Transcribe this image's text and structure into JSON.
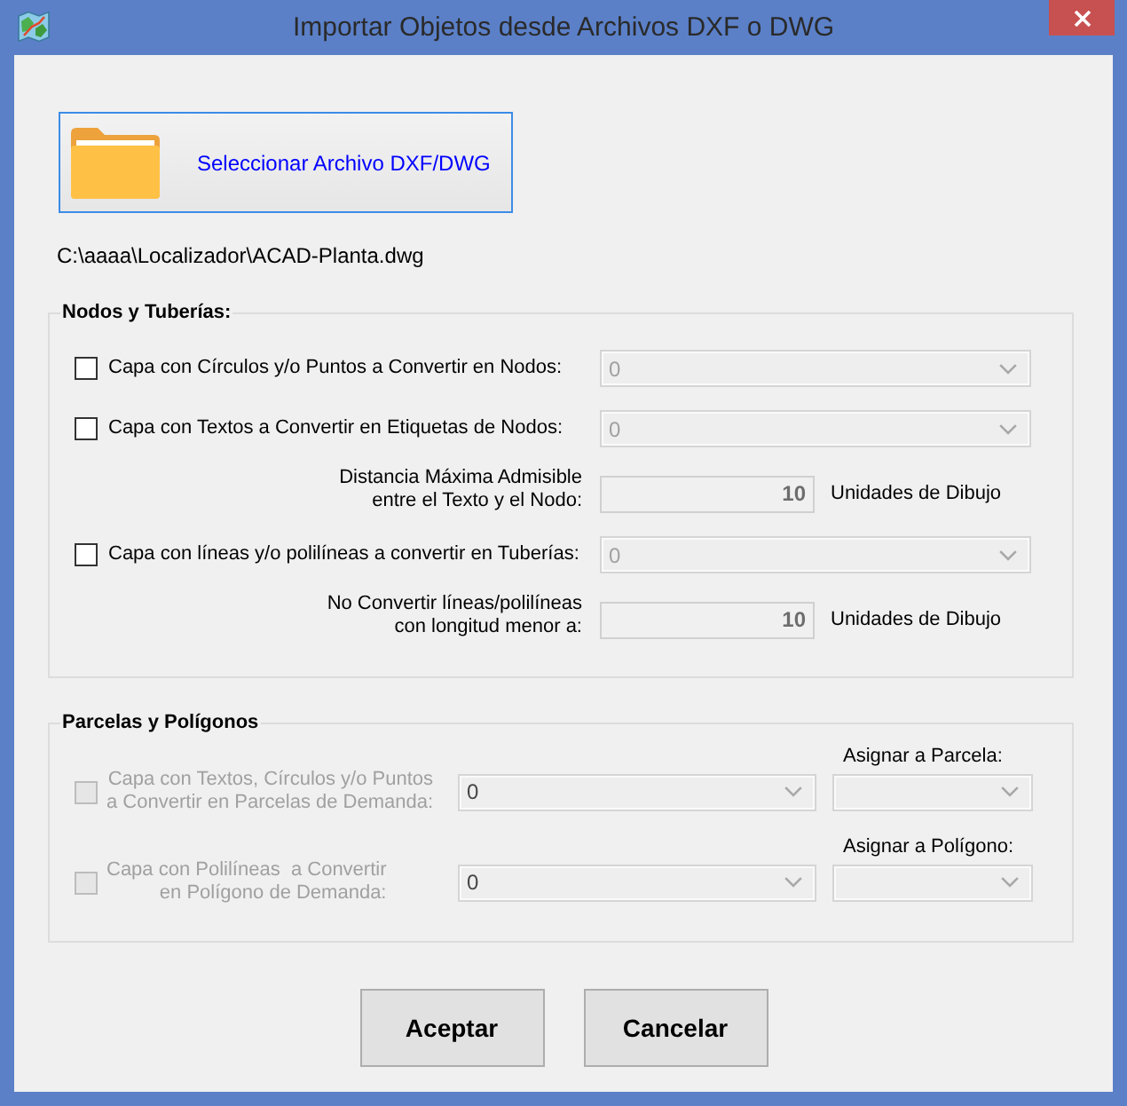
{
  "window": {
    "title": "Importar Objetos desde Archivos DXF o DWG"
  },
  "select_button": {
    "label": "Seleccionar Archivo DXF/DWG",
    "focused": true
  },
  "file_path": "C:\\aaaa\\Localizador\\ACAD-Planta.dwg",
  "groups": [
    {
      "title": "Nodos y Tuberías:",
      "rows": [
        {
          "kind": "layer",
          "label": "Capa con Círculos y/o Puntos a Convertir en Nodos:",
          "checked": false,
          "disabled": false,
          "dropdown": {
            "value": "0",
            "disabled": true
          }
        },
        {
          "kind": "layer",
          "label": "Capa con Textos a Convertir en Etiquetas de Nodos:",
          "checked": false,
          "disabled": false,
          "dropdown": {
            "value": "0",
            "disabled": true
          }
        },
        {
          "kind": "number",
          "label": "Distancia Máxima Admisible\nentre el Texto y el Nodo:",
          "value": "10",
          "unit": "Unidades de Dibujo"
        },
        {
          "kind": "layer",
          "label": "Capa con líneas y/o polilíneas a convertir en Tuberías:",
          "checked": false,
          "disabled": false,
          "dropdown": {
            "value": "0",
            "disabled": true
          }
        },
        {
          "kind": "number",
          "label": "No Convertir líneas/polilíneas\ncon longitud menor a:",
          "value": "10",
          "unit": "Unidades de Dibujo"
        }
      ]
    },
    {
      "title": "Parcelas y Polígonos",
      "rows": [
        {
          "kind": "assign",
          "label": "Capa con Textos, Círculos y/o Puntos\na Convertir en Parcelas de Demanda:",
          "checked": false,
          "disabled": true,
          "dropdown": {
            "value": "0",
            "disabled": false
          },
          "assign_label": "Asignar a Parcela:"
        },
        {
          "kind": "assign",
          "label": "Capa con Polilíneas  a Convertir\nen Polígono de Demanda:",
          "checked": false,
          "disabled": true,
          "dropdown": {
            "value": "0",
            "disabled": false
          },
          "assign_label": "Asignar a Polígono:"
        }
      ]
    }
  ],
  "buttons": [
    {
      "label": "Aceptar"
    },
    {
      "label": "Cancelar"
    }
  ]
}
